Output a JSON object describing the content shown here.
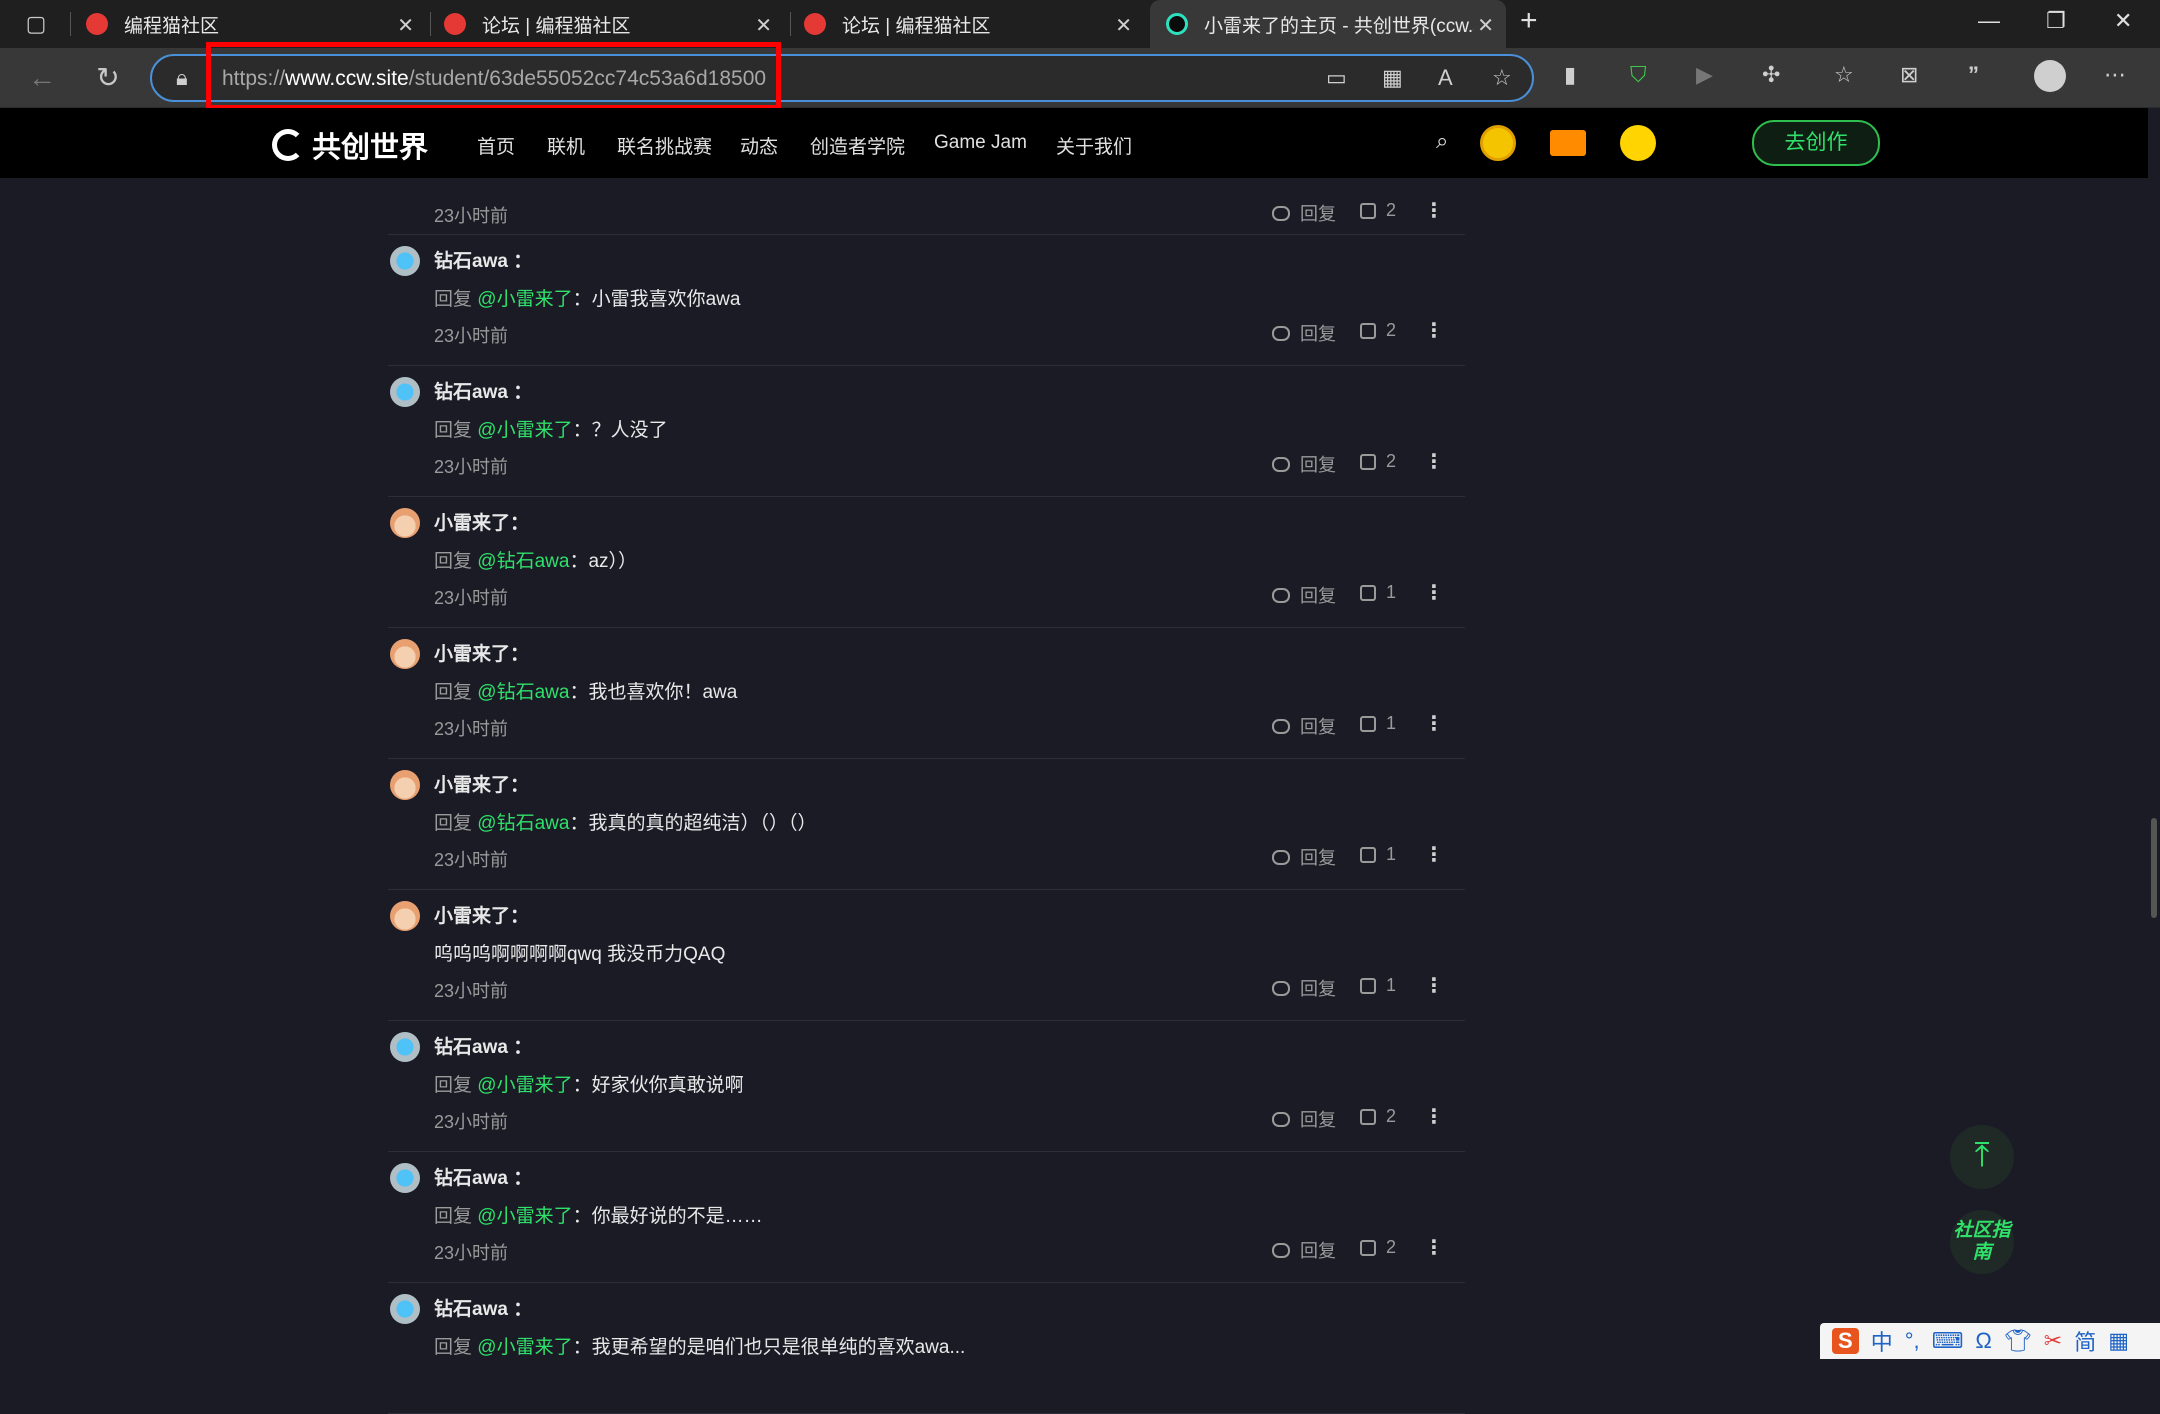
{
  "browser": {
    "tabs": [
      {
        "title": "编程猫社区",
        "active": false
      },
      {
        "title": "论坛 | 编程猫社区",
        "active": false
      },
      {
        "title": "论坛 | 编程猫社区",
        "active": false
      },
      {
        "title": "小雷来了的主页 - 共创世界(ccw.s",
        "active": true
      }
    ],
    "new_tab_label": "+",
    "url_prefix": "https://",
    "url_host": "www.ccw.site",
    "url_path": "/student/63de55052cc74c53a6d18500"
  },
  "site": {
    "logo_text": "共创世界",
    "nav": [
      "首页",
      "联机",
      "联名挑战赛",
      "动态",
      "创造者学院",
      "Game Jam",
      "关于我们"
    ],
    "create_button": "去创作"
  },
  "comments": [
    {
      "name": "钻石awa ：",
      "avatar": "blue",
      "reply_prefix": "回复",
      "at": "@小雷来了",
      "text": "：小雷我喜欢你awa",
      "time": "23小时前",
      "reply_label": "回复",
      "likes": "2"
    },
    {
      "name": "钻石awa ：",
      "avatar": "blue",
      "reply_prefix": "回复",
      "at": "@小雷来了",
      "text": "：？人没了",
      "time": "23小时前",
      "reply_label": "回复",
      "likes": "2"
    },
    {
      "name": "小雷来了：",
      "avatar": "lei",
      "reply_prefix": "回复",
      "at": "@钻石awa",
      "text": "：az））",
      "time": "23小时前",
      "reply_label": "回复",
      "likes": "1"
    },
    {
      "name": "小雷来了：",
      "avatar": "lei",
      "reply_prefix": "回复",
      "at": "@钻石awa",
      "text": "：我也喜欢你！awa",
      "time": "23小时前",
      "reply_label": "回复",
      "likes": "1"
    },
    {
      "name": "小雷来了：",
      "avatar": "lei",
      "reply_prefix": "回复",
      "at": "@钻石awa",
      "text": "：我真的真的超纯洁）（）（）",
      "time": "23小时前",
      "reply_label": "回复",
      "likes": "1"
    },
    {
      "name": "小雷来了：",
      "avatar": "lei",
      "reply_prefix": "",
      "at": "",
      "text": "呜呜呜啊啊啊啊qwq 我没币力QAQ",
      "time": "23小时前",
      "reply_label": "回复",
      "likes": "1"
    },
    {
      "name": "钻石awa ：",
      "avatar": "blue",
      "reply_prefix": "回复",
      "at": "@小雷来了",
      "text": "：好家伙你真敢说啊",
      "time": "23小时前",
      "reply_label": "回复",
      "likes": "2"
    },
    {
      "name": "钻石awa ：",
      "avatar": "blue",
      "reply_prefix": "回复",
      "at": "@小雷来了",
      "text": "：你最好说的不是……",
      "time": "23小时前",
      "reply_label": "回复",
      "likes": "2"
    },
    {
      "name": "钻石awa ：",
      "avatar": "blue",
      "reply_prefix": "回复",
      "at": "@小雷来了",
      "text": "：我更希望的是咱们也只是很单纯的喜欢awa...",
      "time": "",
      "reply_label": "",
      "likes": ""
    }
  ],
  "partial_top": {
    "time": "23小时前",
    "reply_label": "回复",
    "likes": "2"
  },
  "side": {
    "guide_label": "社区指南",
    "to_top_icon": "arrow-up-icon"
  },
  "ime": {
    "mode": "中",
    "simplified": "简"
  }
}
